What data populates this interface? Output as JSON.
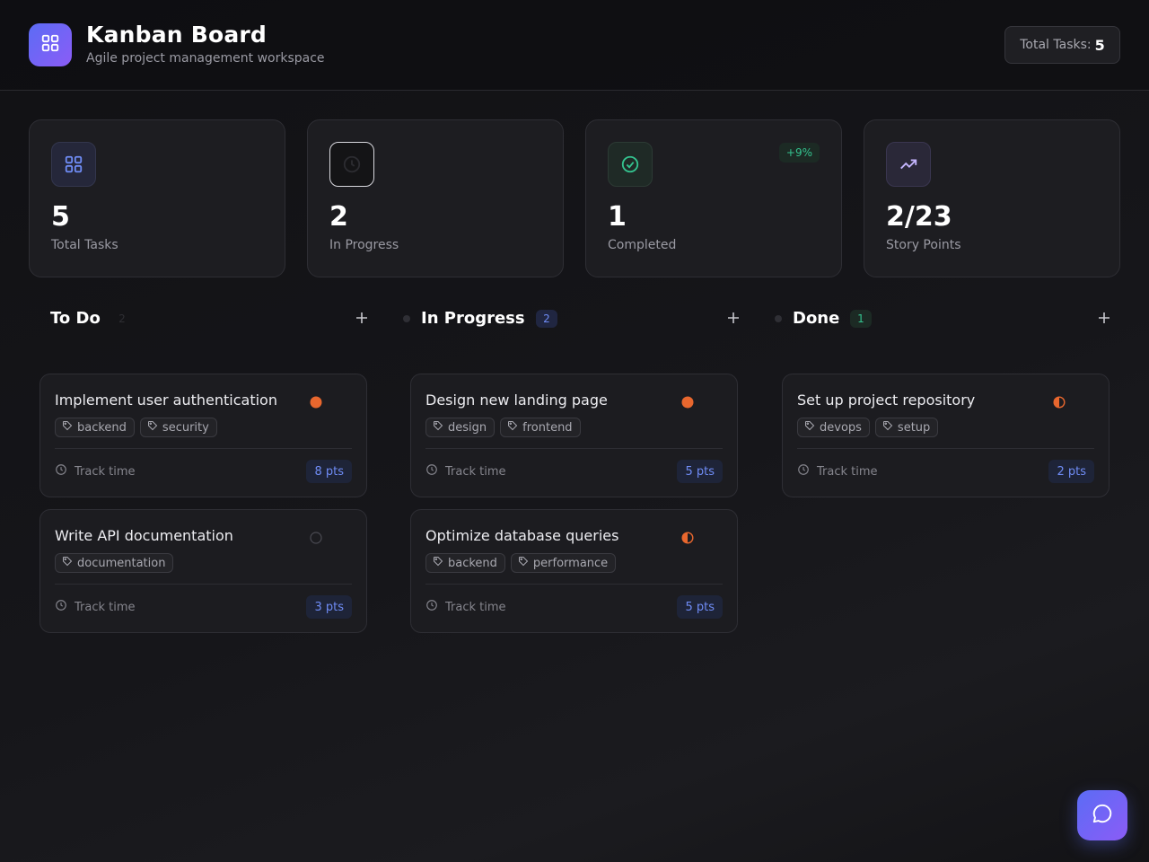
{
  "header": {
    "title": "Kanban Board",
    "subtitle": "Agile project management workspace",
    "total_label": "Total Tasks:",
    "total_value": "5",
    "logo_icon": "grid-icon"
  },
  "stats": [
    {
      "value": "5",
      "label": "Total Tasks",
      "icon": "grid-icon",
      "accent": "#6f8cf5"
    },
    {
      "value": "2",
      "label": "In Progress",
      "icon": "clock-icon",
      "accent": "#3a3a40"
    },
    {
      "value": "1",
      "label": "Completed",
      "icon": "check-circle-icon",
      "accent": "#34c38f",
      "badge": "+9%"
    },
    {
      "value": "2/23",
      "label": "Story Points",
      "icon": "trending-up-icon",
      "accent": "#a78bfa"
    }
  ],
  "columns": [
    {
      "title": "To Do",
      "count": "2",
      "cards": [
        {
          "title": "Implement user authentication",
          "priority": "high",
          "tags": [
            "backend",
            "security"
          ],
          "track_label": "Track time",
          "points": "8 pts"
        },
        {
          "title": "Write API documentation",
          "priority": "low",
          "tags": [
            "documentation"
          ],
          "track_label": "Track time",
          "points": "3 pts"
        }
      ]
    },
    {
      "title": "In Progress",
      "count": "2",
      "cards": [
        {
          "title": "Design new landing page",
          "priority": "high",
          "tags": [
            "design",
            "frontend"
          ],
          "track_label": "Track time",
          "points": "5 pts"
        },
        {
          "title": "Optimize database queries",
          "priority": "medium",
          "tags": [
            "backend",
            "performance"
          ],
          "track_label": "Track time",
          "points": "5 pts"
        }
      ]
    },
    {
      "title": "Done",
      "count": "1",
      "cards": [
        {
          "title": "Set up project repository",
          "priority": "medium",
          "tags": [
            "devops",
            "setup"
          ],
          "track_label": "Track time",
          "points": "2 pts"
        }
      ]
    }
  ],
  "colors": {
    "accent": "#5b6cf5",
    "priority_high": "#e8672e",
    "priority_medium": "#e8672e",
    "priority_low": "#3a3a40",
    "success": "#34c38f"
  },
  "fab_icon": "chat-bubble-icon"
}
